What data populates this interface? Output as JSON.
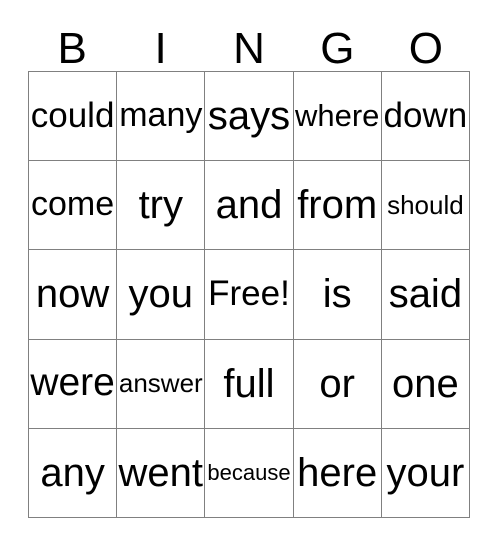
{
  "card": {
    "type": "bingo-card",
    "header_letters": [
      "B",
      "I",
      "N",
      "G",
      "O"
    ],
    "columns": 5,
    "rows": 5,
    "border_color": "#808080",
    "text_color": "#000000",
    "background_color": "#ffffff",
    "free_space_label": "Free!",
    "free_space_position": {
      "row": 3,
      "column": 3
    },
    "rows_data": [
      [
        "could",
        "many",
        "says",
        "where",
        "down"
      ],
      [
        "come",
        "try",
        "and",
        "from",
        "should"
      ],
      [
        "now",
        "you",
        "Free!",
        "is",
        "said"
      ],
      [
        "were",
        "answer",
        "full",
        "or",
        "one"
      ],
      [
        "any",
        "went",
        "because",
        "here",
        "your"
      ]
    ]
  }
}
